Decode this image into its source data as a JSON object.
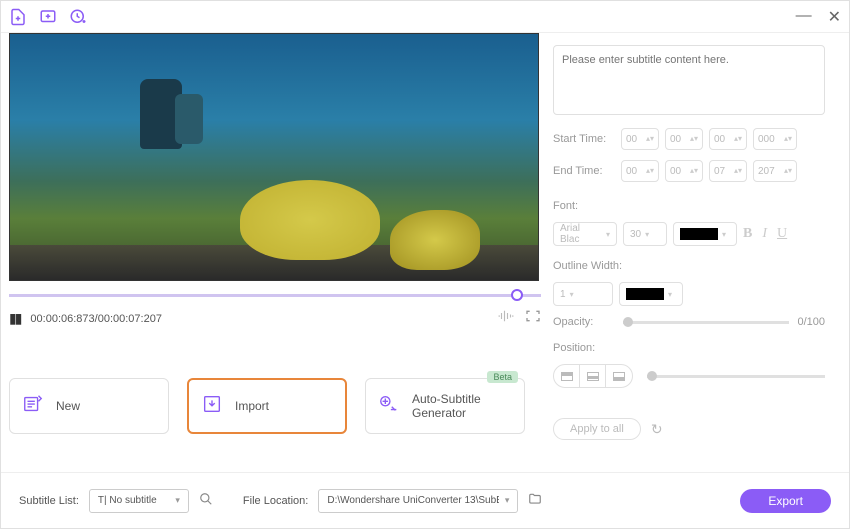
{
  "titlebar": {
    "minimize": "—",
    "close": "✕"
  },
  "player": {
    "time_display": "00:00:06:873/00:00:07:207"
  },
  "actions": {
    "new": "New",
    "import": "Import",
    "auto_subtitle": "Auto-Subtitle Generator",
    "beta": "Beta"
  },
  "subtitle": {
    "placeholder": "Please enter subtitle content here.",
    "start_label": "Start Time:",
    "end_label": "End Time:",
    "start": {
      "h": "00",
      "m": "00",
      "s": "00",
      "ms": "000"
    },
    "end": {
      "h": "00",
      "m": "00",
      "s": "07",
      "ms": "207"
    },
    "font_label": "Font:",
    "font_family": "Arial Blac",
    "font_size": "30",
    "outline_label": "Outline Width:",
    "outline_width": "1",
    "opacity_label": "Opacity:",
    "opacity_value": "0/100",
    "position_label": "Position:",
    "apply_all": "Apply to all"
  },
  "footer": {
    "subtitle_list_label": "Subtitle List:",
    "subtitle_selected": "T| No subtitle",
    "file_location_label": "File Location:",
    "file_location": "D:\\Wondershare UniConverter 13\\SubEdito",
    "export": "Export"
  }
}
